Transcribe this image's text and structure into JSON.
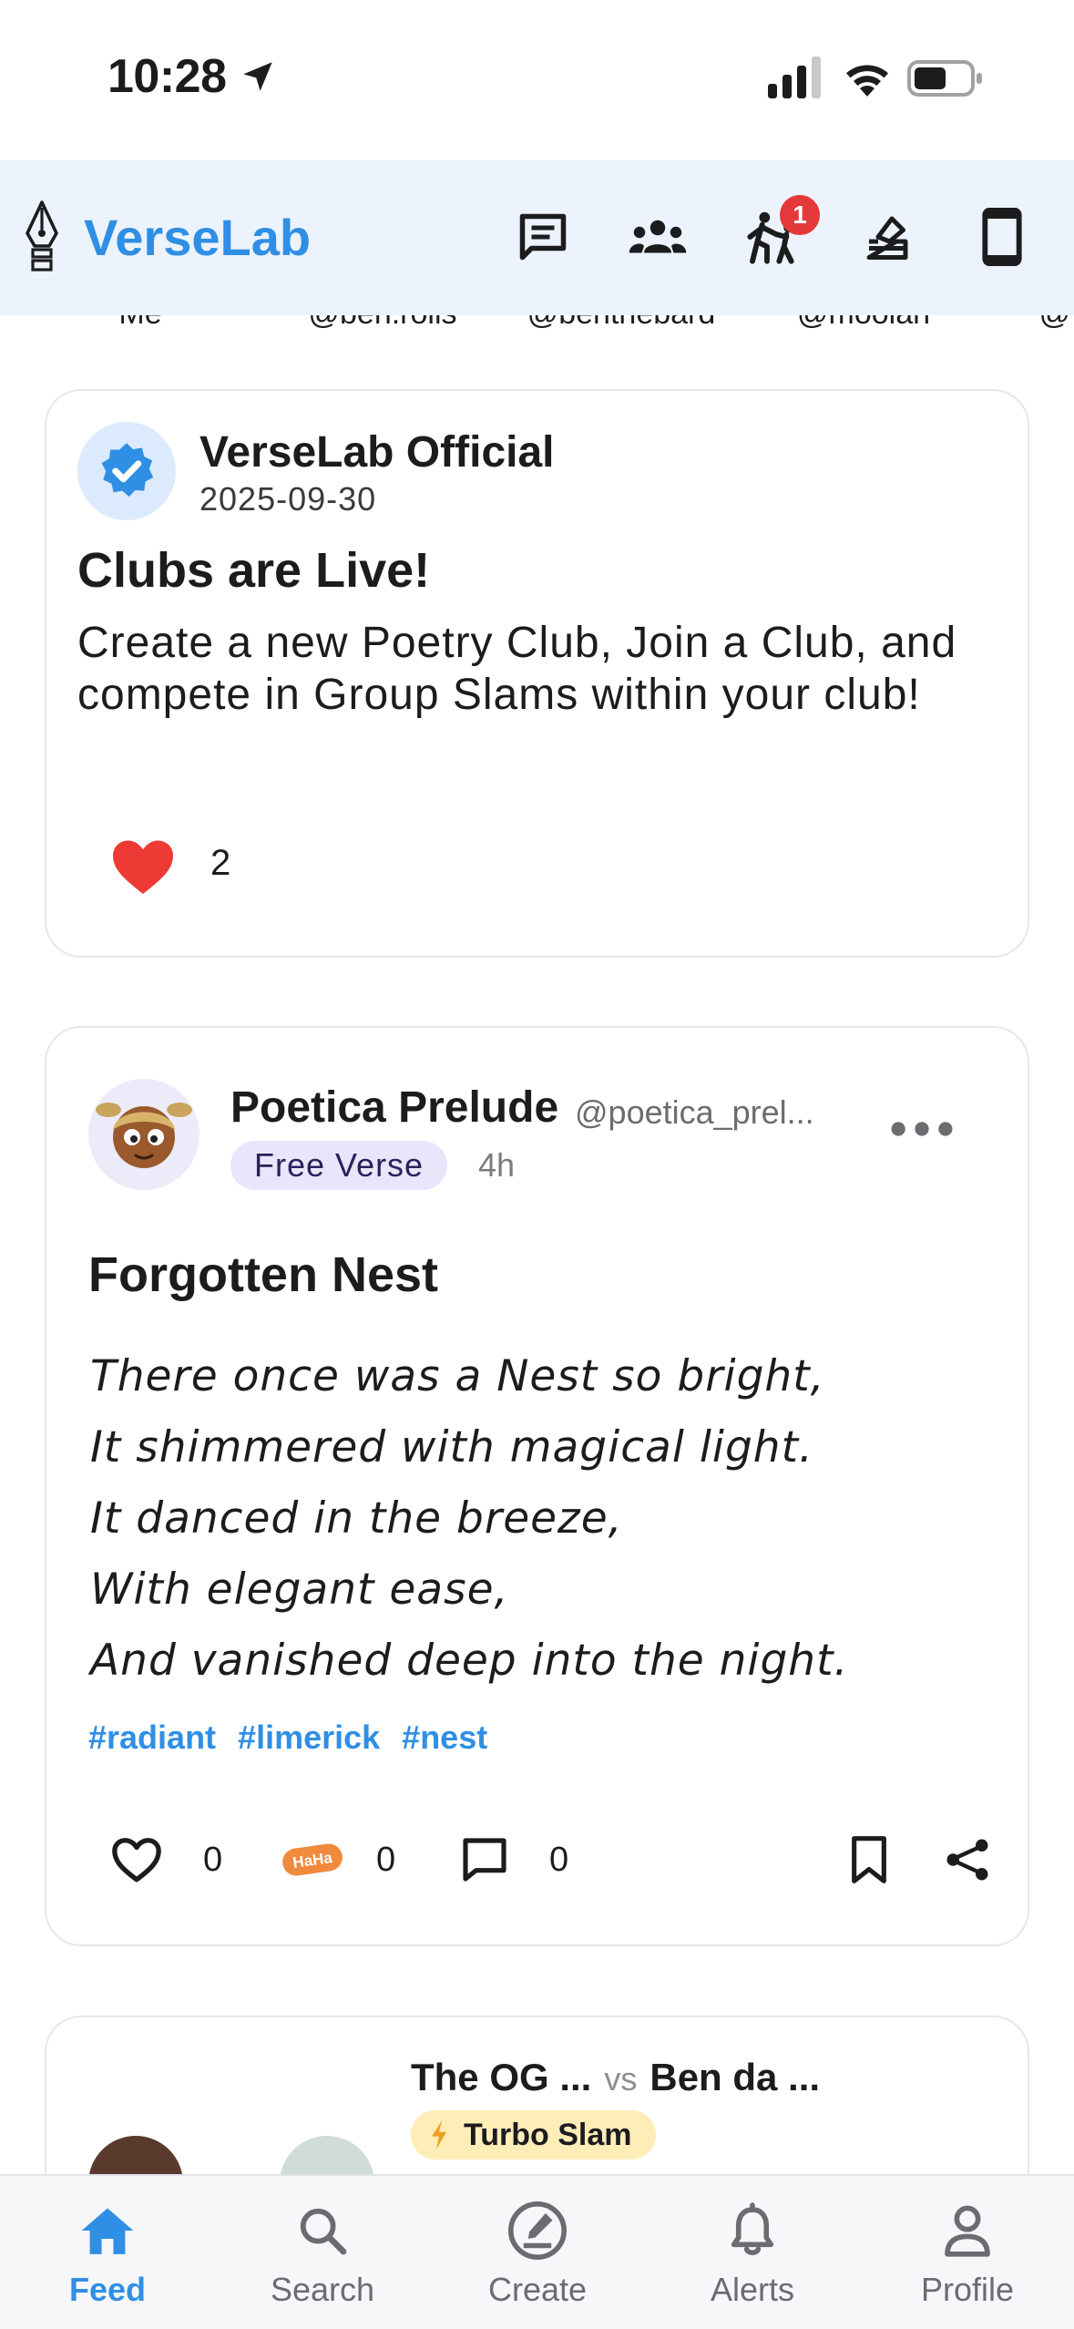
{
  "status_bar": {
    "time": "10:28",
    "icons": [
      "location-arrow-icon",
      "signal-icon",
      "wifi-icon",
      "battery-icon"
    ]
  },
  "header": {
    "app_name": "VerseLab",
    "logo_icon": "fountain-pen-icon",
    "actions": [
      {
        "icon": "chat-icon"
      },
      {
        "icon": "groups-icon"
      },
      {
        "icon": "slam-battle-icon",
        "badge": "1"
      },
      {
        "icon": "vote-ballot-icon"
      },
      {
        "icon": "phone-icon"
      }
    ],
    "accent_color": "#2f8fe4",
    "badge_color": "#e5383b"
  },
  "stories": {
    "labels": [
      "Me",
      "@ben.rolls",
      "@benthebard",
      "@moolah",
      "@"
    ]
  },
  "announcement": {
    "author": "VerseLab Official",
    "date": "2025-09-30",
    "title": "Clubs are Live!",
    "body": "Create a new Poetry Club, Join a Club, and compete in Group Slams within your club!",
    "likes": "2"
  },
  "poem": {
    "author": "Poetica Prelude",
    "handle": "@poetica_prel...",
    "genre": "Free Verse",
    "age": "4h",
    "title": "Forgotten Nest",
    "lines": [
      "There once was a Nest so bright,",
      "It shimmered with magical light.",
      "It danced in the breeze,",
      "With elegant ease,",
      "And vanished deep into the night."
    ],
    "tags": [
      "#radiant",
      "#limerick",
      "#nest"
    ],
    "likes": "0",
    "haha_label": "HaHa",
    "haha": "0",
    "comments": "0"
  },
  "slam": {
    "player1": "The OG ...",
    "vs": "vs",
    "player2": "Ben da ...",
    "type": "Turbo Slam"
  },
  "nav": {
    "items": [
      {
        "label": "Feed",
        "icon": "home-icon",
        "active": true
      },
      {
        "label": "Search",
        "icon": "search-icon"
      },
      {
        "label": "Create",
        "icon": "create-icon"
      },
      {
        "label": "Alerts",
        "icon": "bell-icon"
      },
      {
        "label": "Profile",
        "icon": "person-icon"
      }
    ]
  }
}
